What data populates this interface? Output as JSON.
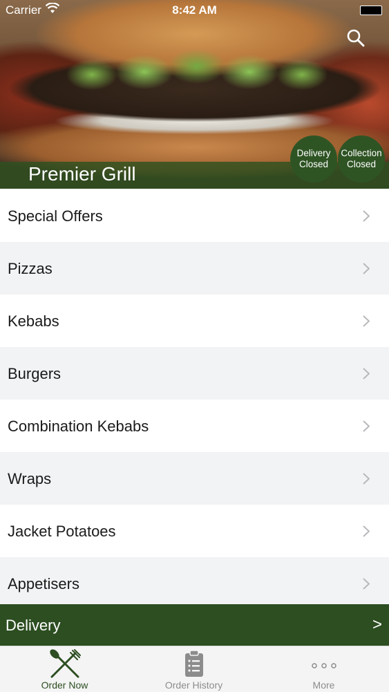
{
  "status_bar": {
    "carrier": "Carrier",
    "time": "8:42 AM"
  },
  "header": {
    "restaurant_name": "Premier Grill",
    "delivery_status": [
      "Delivery",
      "Closed"
    ],
    "collection_status": [
      "Collection",
      "Closed"
    ]
  },
  "menu": {
    "items": [
      {
        "label": "Special Offers"
      },
      {
        "label": "Pizzas"
      },
      {
        "label": "Kebabs"
      },
      {
        "label": "Burgers"
      },
      {
        "label": "Combination Kebabs"
      },
      {
        "label": "Wraps"
      },
      {
        "label": "Jacket Potatoes"
      },
      {
        "label": "Appetisers"
      }
    ]
  },
  "delivery_bar": {
    "label": "Delivery",
    "arrow": ">"
  },
  "tabs": [
    {
      "label": "Order Now",
      "icon": "fork-knife-icon",
      "active": true
    },
    {
      "label": "Order History",
      "icon": "clipboard-icon",
      "active": false
    },
    {
      "label": "More",
      "icon": "more-dots-icon",
      "active": false
    }
  ],
  "colors": {
    "brand_green": "#2c4e21",
    "tab_inactive": "#8c8c8c"
  }
}
